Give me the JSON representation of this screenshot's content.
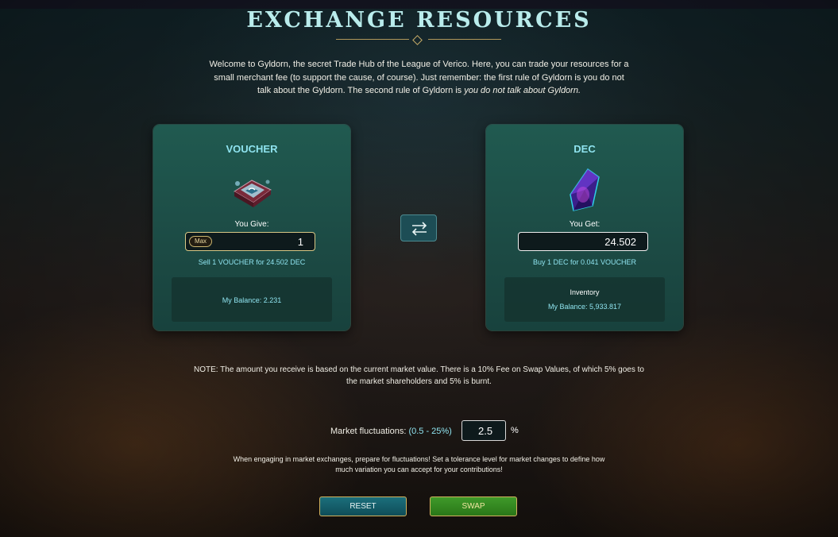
{
  "page": {
    "title": "EXCHANGE RESOURCES",
    "intro_main": "Welcome to Gyldorn, the secret Trade Hub of the League of Verico. Here, you can trade your resources for a small merchant fee (to support the cause, of course). Just remember: the first rule of Gyldorn is you do not talk about the Gyldorn. The second rule of Gyldorn is ",
    "intro_italic": "you do not talk about Gyldorn."
  },
  "give": {
    "title": "VOUCHER",
    "icon": "voucher-chest-icon",
    "label": "You Give:",
    "max_label": "Max",
    "amount": "1",
    "rate": "Sell 1 VOUCHER for 24.502 DEC",
    "balance": "My Balance: 2.231"
  },
  "get": {
    "title": "DEC",
    "icon": "dec-crystal-icon",
    "label": "You Get:",
    "amount": "24.502",
    "rate": "Buy 1 DEC for 0.041 VOUCHER",
    "inventory_label": "Inventory",
    "balance": "My Balance: 5,933.817"
  },
  "swap_direction_icon": "swap-arrows-icon",
  "note": "NOTE: The amount you receive is based on the current market value. There is a 10% Fee on Swap Values, of which 5% goes to the market shareholders and 5% is burnt.",
  "fluctuation": {
    "label": "Market fluctuations: ",
    "range": "(0.5 - 25%)",
    "value": "2.5",
    "unit": "%"
  },
  "tolerance_text": "When engaging in market exchanges, prepare for fluctuations! Set a tolerance level for market changes to define how much variation you can accept for your contributions!",
  "buttons": {
    "reset": "RESET",
    "swap": "SWAP"
  },
  "colors": {
    "accent": "#8fe3ef",
    "gold": "#d2b25e",
    "panel": "#1c4a44",
    "reset": "#1b6f7c",
    "swap": "#3f9a2a"
  }
}
